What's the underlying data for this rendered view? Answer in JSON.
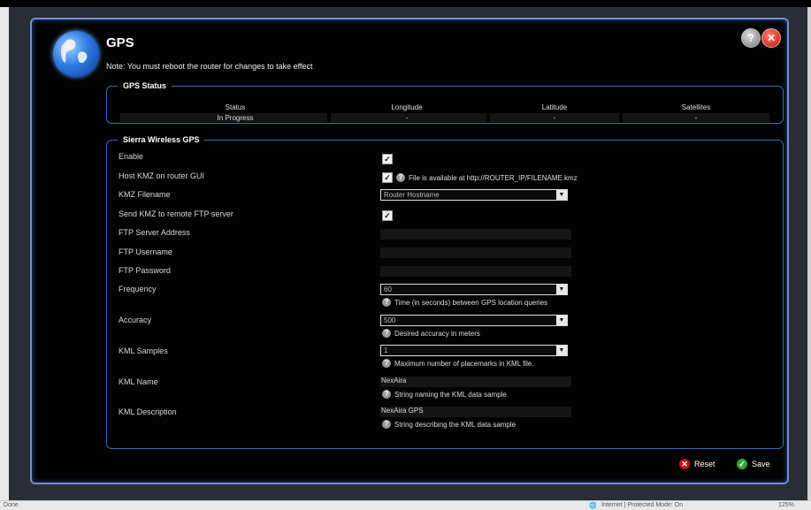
{
  "header": {
    "title": "GPS",
    "note": "Note: You must reboot the router for changes to take effect"
  },
  "icons": {
    "logo": "globe-icon",
    "help": "help-icon",
    "close": "close-icon",
    "reset": "reset-icon",
    "save": "save-icon"
  },
  "colors": {
    "accent_border": "#6f8fd0",
    "group_border": "#3d66b8",
    "close_red": "#c0170f",
    "save_green": "#3aa53a"
  },
  "gps_status": {
    "legend": "GPS Status",
    "columns": [
      "Status",
      "Longitude",
      "Latitude",
      "Satellites"
    ],
    "values": [
      "In Progress",
      "-",
      "-",
      "-"
    ]
  },
  "sierra": {
    "legend": "Sierra Wireless GPS",
    "enable_label": "Enable",
    "host_kmz_label": "Host KMZ on router GUI",
    "host_kmz_help": "File is available at http://ROUTER_IP/FILENAME.kmz",
    "kmz_filename_label": "KMZ Filename",
    "kmz_filename_value": "Router Hostname",
    "send_kmz_label": "Send KMZ to remote FTP server",
    "ftp_server_label": "FTP Server Address",
    "ftp_username_label": "FTP Username",
    "ftp_password_label": "FTP Password",
    "frequency_label": "Frequency",
    "frequency_value": "60",
    "frequency_help": "Time (in seconds) between GPS location queries",
    "accuracy_label": "Accuracy",
    "accuracy_value": "500",
    "accuracy_help": "Desired accuracy in meters",
    "kml_samples_label": "KML Samples",
    "kml_samples_value": "1",
    "kml_samples_help": "Maximum number of placemarks in KML file.",
    "kml_name_label": "KML Name",
    "kml_name_value": "NexAira",
    "kml_name_help": "String naming the KML data sample",
    "kml_desc_label": "KML Description",
    "kml_desc_value": "NexAira GPS",
    "kml_desc_help": "String describing the KML data sample"
  },
  "actions": {
    "reset": "Reset",
    "save": "Save"
  },
  "browser_status": {
    "left": "Done",
    "zone": "Internet | Protected Mode: On",
    "zoom": "125%"
  }
}
